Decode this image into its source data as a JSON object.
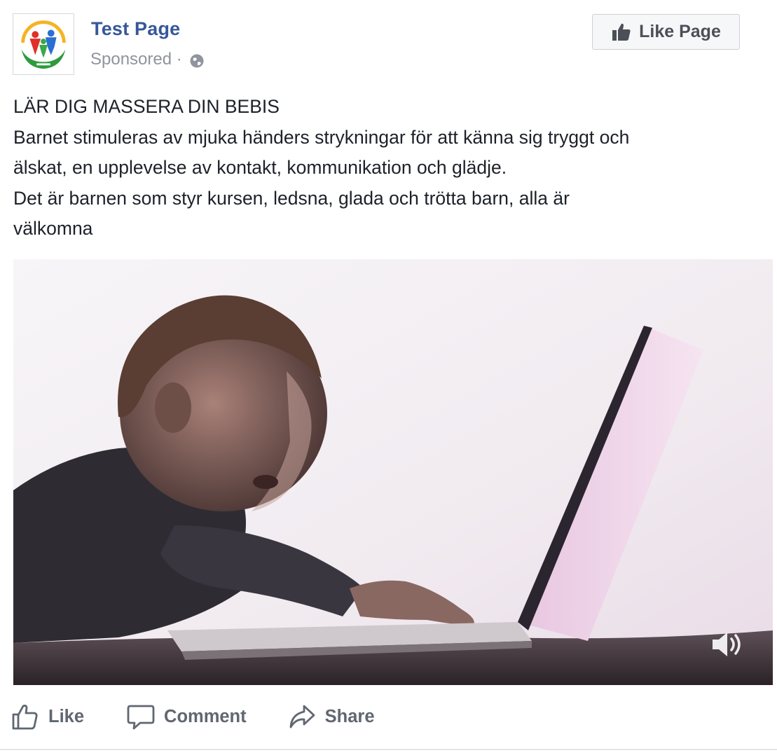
{
  "post": {
    "page_name": "Test Page",
    "sponsored_label": "Sponsored ·",
    "avatar_icon": "organization-logo-icon",
    "privacy_icon": "globe-icon",
    "like_page_button": {
      "label": "Like Page",
      "icon": "thumbs-up-icon"
    },
    "text_lines": [
      "LÄR DIG MASSERA DIN BEBIS",
      "Barnet stimuleras av mjuka händers strykningar för att känna sig tryggt och",
      "älskat, en upplevelse av kontakt, kommunikation och glädje.",
      "Det är barnen som styr kursen, ledsna, glada och trötta barn, alla är",
      "välkomna"
    ],
    "media": {
      "type": "video",
      "volume_icon": "speaker-volume-icon"
    },
    "actions": [
      {
        "label": "Like",
        "icon": "like-thumb-icon"
      },
      {
        "label": "Comment",
        "icon": "comment-bubble-icon"
      },
      {
        "label": "Share",
        "icon": "share-arrow-icon"
      }
    ]
  },
  "colors": {
    "page_name": "#365899",
    "meta_text": "#90949c",
    "body_text": "#1d2129",
    "action_text": "#606770",
    "button_bg": "#f6f7f9",
    "button_border": "#ccd0d5"
  }
}
